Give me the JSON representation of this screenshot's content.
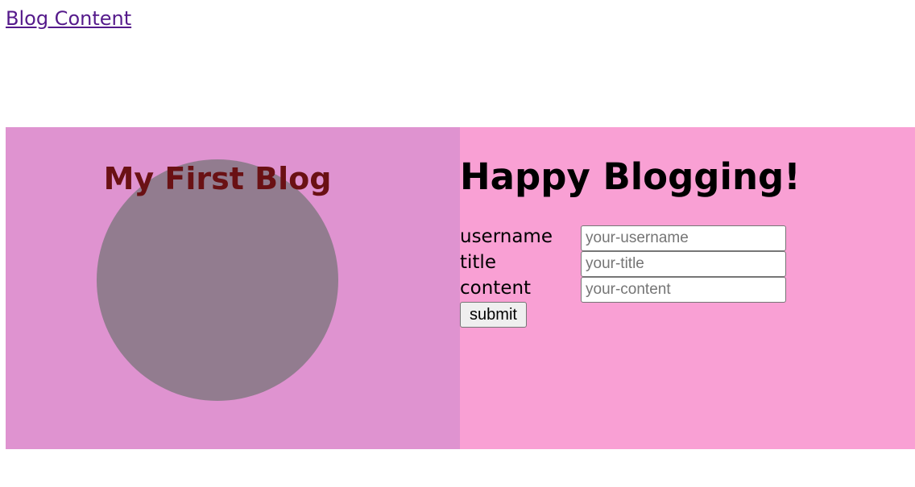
{
  "nav": {
    "link_label": "Blog Content",
    "link_color": "#551a8b"
  },
  "hero": {
    "title": "My First Blog",
    "panel_color": "#df93d0",
    "circle_color": "#927c8f",
    "title_color": "#6a1114"
  },
  "form_panel": {
    "heading": "Happy Blogging!",
    "panel_color": "#f9a0d4",
    "fields": [
      {
        "label": "username",
        "placeholder": "your-username",
        "value": ""
      },
      {
        "label": "title",
        "placeholder": "your-title",
        "value": ""
      },
      {
        "label": "content",
        "placeholder": "your-content",
        "value": ""
      }
    ],
    "submit_label": "submit"
  }
}
